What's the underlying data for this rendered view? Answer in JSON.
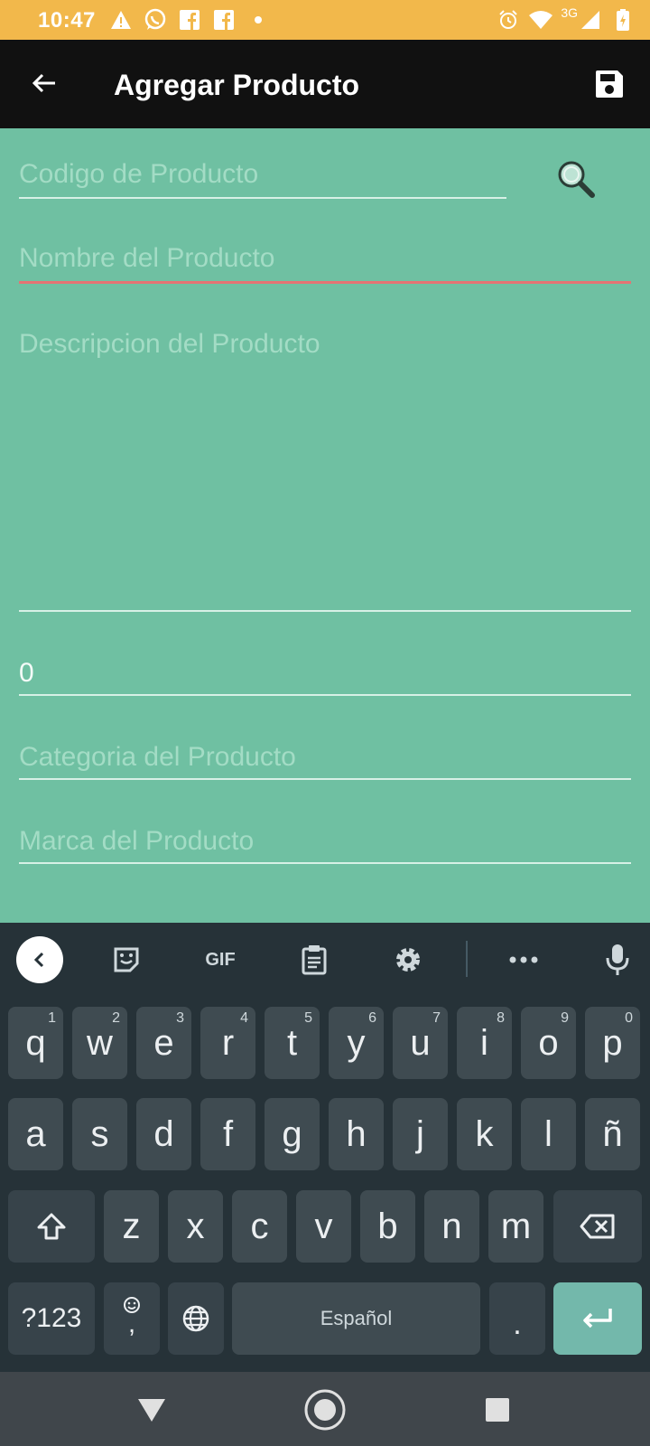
{
  "status_bar": {
    "time": "10:47",
    "network": "3G",
    "left_icons": [
      "warning-icon",
      "whatsapp-icon",
      "facebook-icon",
      "facebook-icon",
      "dot-icon"
    ],
    "right_icons": [
      "alarm-icon",
      "wifi-icon",
      "signal-icon",
      "battery-icon"
    ]
  },
  "toolbar": {
    "title": "Agregar Producto",
    "back_icon": "arrow-back-icon",
    "save_icon": "save-icon"
  },
  "form": {
    "codigo": {
      "placeholder": "Codigo de Producto",
      "value": ""
    },
    "nombre": {
      "placeholder": "Nombre del Producto",
      "value": "",
      "focused": true,
      "underline_color": "#e57373"
    },
    "descripcion": {
      "placeholder": "Descripcion del Producto",
      "value": ""
    },
    "precio": {
      "value": "0"
    },
    "categoria": {
      "placeholder": "Categoria del Producto",
      "value": ""
    },
    "marca": {
      "placeholder": "Marca del Producto",
      "value": ""
    },
    "search_icon": "magnifier-icon"
  },
  "keyboard": {
    "toolbar_items": [
      "collapse-icon",
      "sticker-icon",
      "GIF",
      "clipboard-icon",
      "settings-icon",
      "more-icon",
      "mic-icon"
    ],
    "gif_label": "GIF",
    "row1": [
      {
        "k": "q",
        "h": "1"
      },
      {
        "k": "w",
        "h": "2"
      },
      {
        "k": "e",
        "h": "3"
      },
      {
        "k": "r",
        "h": "4"
      },
      {
        "k": "t",
        "h": "5"
      },
      {
        "k": "y",
        "h": "6"
      },
      {
        "k": "u",
        "h": "7"
      },
      {
        "k": "i",
        "h": "8"
      },
      {
        "k": "o",
        "h": "9"
      },
      {
        "k": "p",
        "h": "0"
      }
    ],
    "row2": [
      "a",
      "s",
      "d",
      "f",
      "g",
      "h",
      "j",
      "k",
      "l",
      "ñ"
    ],
    "row3": [
      "z",
      "x",
      "c",
      "v",
      "b",
      "n",
      "m"
    ],
    "symbols_label": "?123",
    "emoji_comma_label": ",",
    "space_label": "Español",
    "period_label": ".",
    "accent_color": "#73b8ab"
  },
  "nav_bar": {
    "icons": [
      "back-triangle-icon",
      "home-circle-icon",
      "recents-square-icon"
    ]
  },
  "colors": {
    "status_bar": "#f2b84b",
    "toolbar": "#111111",
    "form_background": "#6fc0a2",
    "keyboard": "#263238"
  }
}
